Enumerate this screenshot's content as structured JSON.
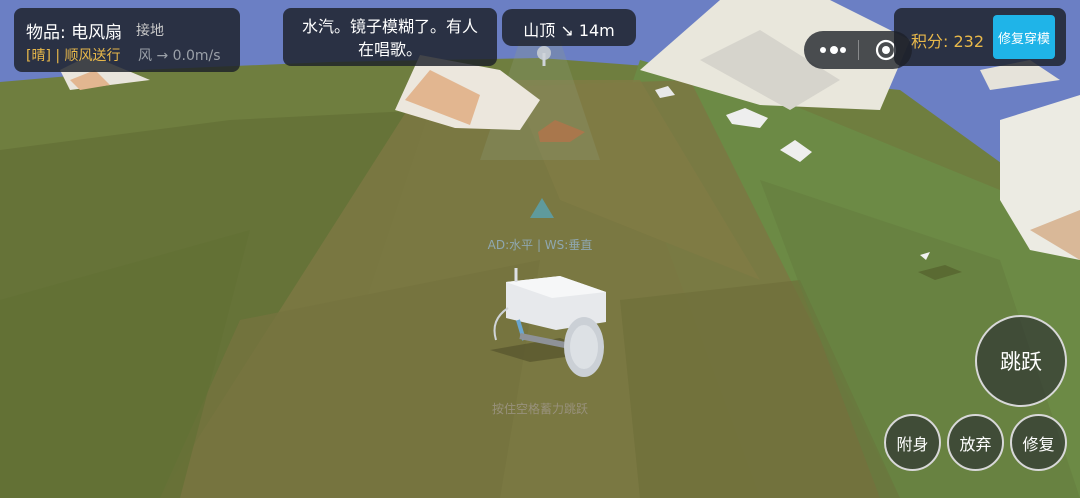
{
  "hud": {
    "item_label": "物品: 电风扇",
    "item_state": "接地",
    "weather": "[晴] | 顺风送行",
    "wind": "风 → 0.0m/s",
    "message": "水汽。镜子模糊了。有人\n在唱歌。",
    "target": "山顶 ↘ 14m",
    "score": "积分: 232",
    "repair_wear_label": "修复穿模",
    "control_hint": "AD:水平 | WS:垂直",
    "jump_hint": "按住空格蓄力跳跃"
  },
  "buttons": {
    "jump": "跳跃",
    "attach": "附身",
    "drop": "放弃",
    "repair": "修复"
  },
  "colors": {
    "sky": "#6b7fc4",
    "grass": "#6e7d3c",
    "path": "#7d7a42",
    "accent_gold": "#e8b84a",
    "button_blue": "#1fb4e8",
    "marker": "#5f9a9c"
  },
  "icons": [
    "more-dots-icon",
    "target-icon",
    "direction-marker-icon"
  ]
}
